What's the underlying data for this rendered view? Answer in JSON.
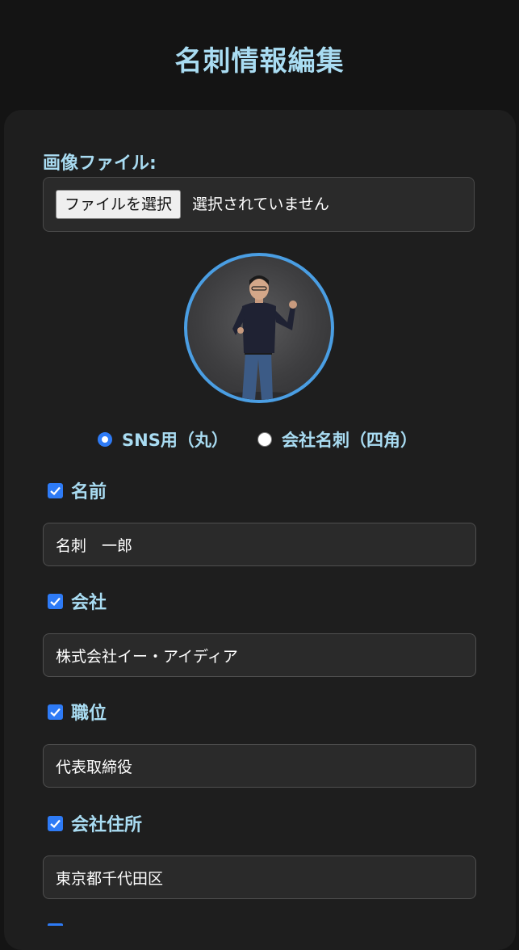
{
  "page": {
    "title": "名刺情報編集"
  },
  "image_file": {
    "label": "画像ファイル:",
    "button_label": "ファイルを選択",
    "status": "選択されていません"
  },
  "shape_options": [
    {
      "label": "SNS用（丸）",
      "selected": true
    },
    {
      "label": "会社名刺（四角）",
      "selected": false
    }
  ],
  "fields": [
    {
      "label": "名前",
      "checked": true,
      "value": "名刺　一郎"
    },
    {
      "label": "会社",
      "checked": true,
      "value": "株式会社イー・アイディア"
    },
    {
      "label": "職位",
      "checked": true,
      "value": "代表取締役"
    },
    {
      "label": "会社住所",
      "checked": true,
      "value": "東京都千代田区"
    }
  ],
  "colors": {
    "accent_text": "#a9dcf2",
    "control_blue": "#2e7bf6",
    "avatar_ring": "#4a9ee3",
    "background": "#141414",
    "card": "#1e1e1e"
  }
}
